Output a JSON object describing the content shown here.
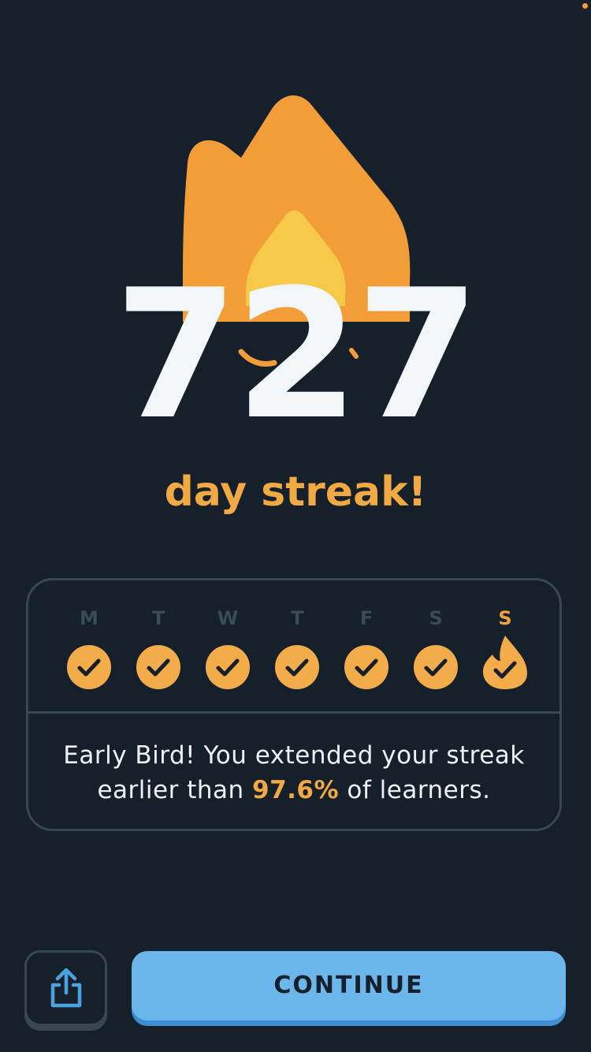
{
  "streak": {
    "count": "727",
    "label": "day streak!"
  },
  "week": {
    "days": [
      {
        "letter": "M",
        "status": "checked"
      },
      {
        "letter": "T",
        "status": "checked"
      },
      {
        "letter": "W",
        "status": "checked"
      },
      {
        "letter": "T",
        "status": "checked"
      },
      {
        "letter": "F",
        "status": "checked"
      },
      {
        "letter": "S",
        "status": "checked"
      },
      {
        "letter": "S",
        "status": "today"
      }
    ]
  },
  "message": {
    "prefix": "Early Bird! You extended your streak earlier than",
    "percent": "97.6%",
    "suffix": "of learners."
  },
  "buttons": {
    "continue_label": "CONTINUE",
    "share_icon": "share-icon"
  },
  "colors": {
    "background": "#16202a",
    "accent_orange": "#f1a943",
    "flame_outer": "#f29d37",
    "flame_inner": "#f7c948",
    "continue_blue": "#6bb7ec",
    "share_blue": "#4aa3e0",
    "card_border": "#3a4650"
  }
}
